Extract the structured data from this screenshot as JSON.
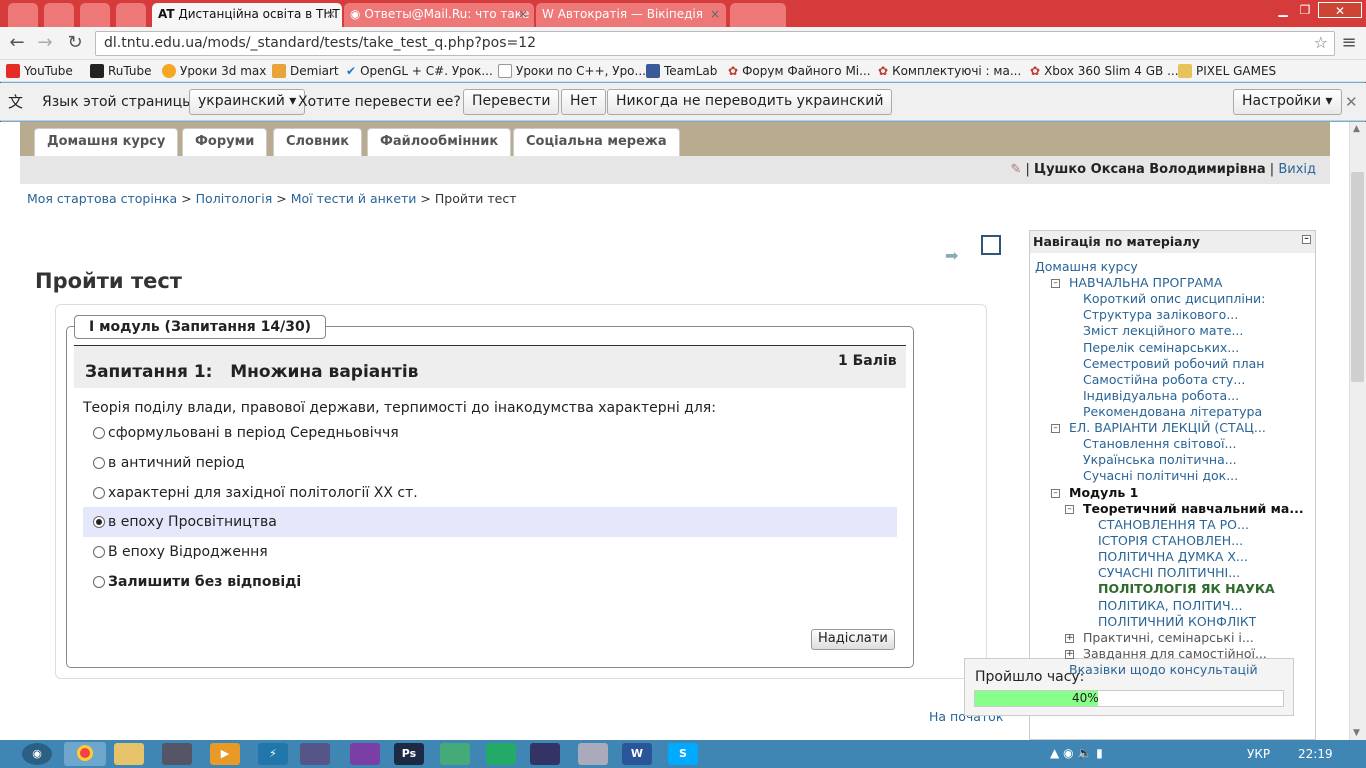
{
  "browser": {
    "tabs": [
      {
        "title": "Дистанційна освіта в ТНТ",
        "icon": "at-icon"
      },
      {
        "title": "Ответы@Mail.Ru: что таке",
        "icon": "mailru-icon"
      },
      {
        "title": "Автократія — Вікіпедія",
        "icon": "wikipedia-icon"
      }
    ],
    "active_tab_glyph": "AT",
    "url": "dl.tntu.edu.ua/mods/_standard/tests/take_test_q.php?pos=12",
    "bookmarks": [
      {
        "label": "YouTube",
        "color": "#e52d27"
      },
      {
        "label": "RuTube",
        "color": "#222222"
      },
      {
        "label": "Уроки 3d max",
        "color": "#f5a623"
      },
      {
        "label": "Demiart",
        "color": "#e8a33a"
      },
      {
        "label": "OpenGL + C#. Урок...",
        "color": "#1f78d1"
      },
      {
        "label": "Уроки по C++, Уро...",
        "color": "#999999"
      },
      {
        "label": "TeamLab",
        "color": "#3a5a99"
      },
      {
        "label": "Форум Файного Мі...",
        "color": "#c0392b"
      },
      {
        "label": "Комплектуючі : ма...",
        "color": "#c0392b"
      },
      {
        "label": "Xbox 360 Slim 4 GB ...",
        "color": "#c0392b"
      },
      {
        "label": "PIXEL GAMES",
        "color": "#e8c25a"
      }
    ]
  },
  "translate_bar": {
    "prompt": "Язык этой страницы",
    "language": "украинский",
    "question": "Хотите перевести ее?",
    "translate": "Перевести",
    "no": "Нет",
    "never": "Никогда не переводить украинский",
    "settings": "Настройки"
  },
  "course_tabs": [
    "Домашня курсу",
    "Форуми",
    "Словник",
    "Файлообмінник",
    "Соціальна мережа"
  ],
  "user": {
    "name": "Цушко Оксана Володимирівна",
    "separator": "|",
    "logout": "Вихід"
  },
  "breadcrumb": {
    "items": [
      "Моя стартова сторінка",
      "Політологія",
      "Мої тести й анкети"
    ],
    "separator": ">",
    "current": "Пройти тест"
  },
  "page_title": "Пройти тест",
  "quiz": {
    "module": "І модуль (Запитання 14/30)",
    "question_label": "Запитання 1:",
    "question_type": "Множина варіантів",
    "points": "1 Балів",
    "question_text": "Теорія поділу влади, правової держави, терпимості до інакодумства характерні для:",
    "options": [
      "сформульовані в період Середньовіччя",
      "в античний період",
      "характерні для західної політології XX ст.",
      "в епоху Просвітництва",
      "В епоху Відродження",
      "Залишити без відповіді"
    ],
    "selected_index": 3,
    "submit": "Надіслати",
    "to_top": "На початок"
  },
  "nav": {
    "title": "Навігація по матеріалу",
    "items": [
      {
        "label": "Домашня курсу",
        "style": "link"
      },
      {
        "label": "НАВЧАЛЬНА ПРОГРАМА",
        "style": "link"
      },
      {
        "label": "Короткий опис дисципліни:",
        "style": "link"
      },
      {
        "label": "Структура залікового...",
        "style": "link"
      },
      {
        "label": "Зміст лекційного мате...",
        "style": "link"
      },
      {
        "label": "Перелік семінарських...",
        "style": "link"
      },
      {
        "label": "Семестровий робочий план",
        "style": "link"
      },
      {
        "label": "Самостійна робота сту...",
        "style": "link"
      },
      {
        "label": "Індивідуальна робота...",
        "style": "link"
      },
      {
        "label": "Рекомендована література",
        "style": "link"
      },
      {
        "label": "ЕЛ. ВАРІАНТИ ЛЕКЦІЙ (СТАЦ...",
        "style": "link"
      },
      {
        "label": "Становлення світової...",
        "style": "link"
      },
      {
        "label": "Українська політична...",
        "style": "link"
      },
      {
        "label": "Сучасні політичні док...",
        "style": "link"
      },
      {
        "label": "Модуль 1",
        "style": "bold"
      },
      {
        "label": "Теоретичний навчальний ма...",
        "style": "bold"
      },
      {
        "label": "СТАНОВЛЕННЯ ТА РО...",
        "style": "link"
      },
      {
        "label": "ІСТОРІЯ СТАНОВЛЕН...",
        "style": "link"
      },
      {
        "label": "ПОЛІТИЧНА ДУМКА Х...",
        "style": "link"
      },
      {
        "label": "СУЧАСНІ ПОЛІТИЧНІ...",
        "style": "link"
      },
      {
        "label": "ПОЛІТОЛОГІЯ ЯК НАУКА",
        "style": "current"
      },
      {
        "label": "ПОЛІТИКА, ПОЛІТИЧ...",
        "style": "link"
      },
      {
        "label": "ПОЛІТИЧНИЙ КОНФЛІКТ",
        "style": "link"
      },
      {
        "label": "Практичні, семінарські і...",
        "style": "grey"
      },
      {
        "label": "Завдання для самостійної...",
        "style": "grey"
      },
      {
        "label": "Вказівки щодо консультацій",
        "style": "link"
      }
    ]
  },
  "timer": {
    "label": "Пройшло часу:",
    "percent_text": "40%",
    "progress": 0.4
  },
  "taskbar": {
    "lang": "УКР",
    "time": "22:19"
  }
}
